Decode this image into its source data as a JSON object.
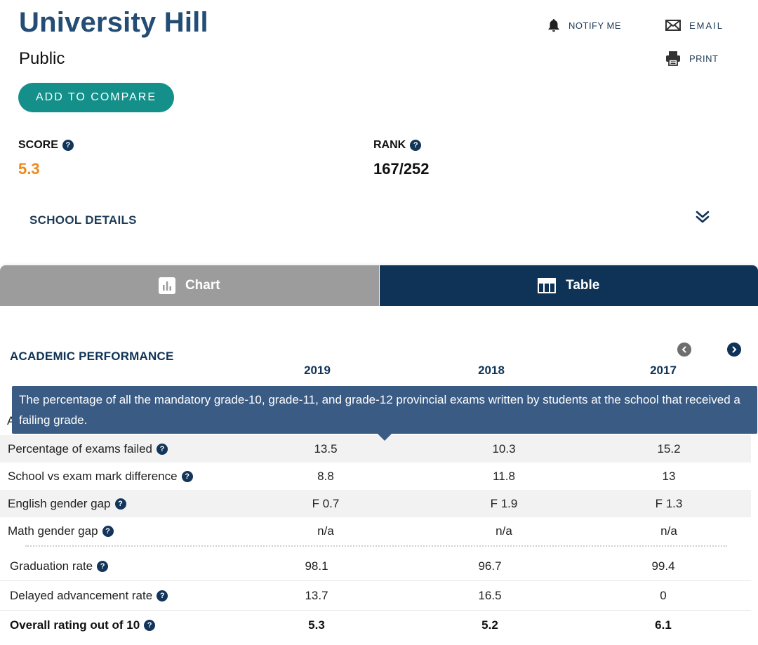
{
  "school": {
    "name": "University Hill",
    "type": "Public",
    "compare_label": "ADD TO COMPARE"
  },
  "actions": {
    "notify": "NOTIFY ME",
    "email": "EMAIL",
    "print": "PRINT"
  },
  "metrics": {
    "score_label": "SCORE",
    "score_value": "5.3",
    "rank_label": "RANK",
    "rank_value": "167/252",
    "help_glyph": "?"
  },
  "details_label": "SCHOOL DETAILS",
  "tabs": {
    "chart": "Chart",
    "table": "Table",
    "active": "Table"
  },
  "section": {
    "title": "ACADEMIC PERFORMANCE",
    "cutoff_row_prefix": "A"
  },
  "years": [
    "2019",
    "2018",
    "2017"
  ],
  "tooltip": "The percentage of all the mandatory grade-10, grade-11, and grade-12 provincial exams written by students at the school that received a failing grade.",
  "rows_top": [
    {
      "label": "Percentage of exams failed",
      "values": [
        "13.5",
        "10.3",
        "15.2"
      ]
    },
    {
      "label": "School vs exam mark difference",
      "values": [
        "8.8",
        "11.8",
        "13"
      ]
    },
    {
      "label": "English gender gap",
      "values": [
        "F 0.7",
        "F 1.9",
        "F 1.3"
      ]
    },
    {
      "label": "Math gender gap",
      "values": [
        "n/a",
        "n/a",
        "n/a"
      ]
    }
  ],
  "rows_bottom": [
    {
      "label": "Graduation rate",
      "values": [
        "98.1",
        "96.7",
        "99.4"
      ]
    },
    {
      "label": "Delayed advancement rate",
      "values": [
        "13.7",
        "16.5",
        "0"
      ]
    },
    {
      "label": "Overall rating out of 10",
      "values": [
        "5.3",
        "5.2",
        "6.1"
      ]
    }
  ],
  "colors": {
    "brand_navy": "#0f3257",
    "teal": "#148f8a",
    "score_orange": "#ef8a1a",
    "tooltip_bg": "#3a5b84"
  }
}
